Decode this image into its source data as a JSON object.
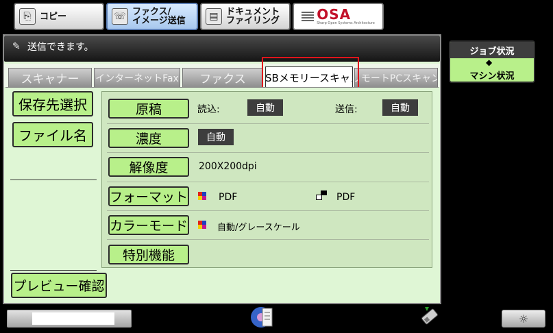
{
  "mode_bar": {
    "copy_label": "コピー",
    "fax_image_label_line1": "ファクス/",
    "fax_image_label_line2": "イメージ送信",
    "doc_filing_label_line1": "ドキュメント",
    "doc_filing_label_line2": "ファイリング",
    "osa_logo_text": "OSA",
    "osa_logo_sub": "Sharp Open Systems Architecture"
  },
  "status": {
    "message": "送信できます。"
  },
  "tabs": [
    {
      "label": "スキャナー",
      "active": false
    },
    {
      "label": "インターネットFax",
      "active": false
    },
    {
      "label": "ファクス",
      "active": false
    },
    {
      "label": "USBメモリースキャン",
      "active": true
    },
    {
      "label": "リモートPCスキャン",
      "active": false
    }
  ],
  "side": {
    "destination_button": "保存先選択",
    "filename_button": "ファイル名",
    "preview_button": "プレビュー確認"
  },
  "settings": {
    "original": {
      "button": "原稿",
      "read_label": "読込:",
      "read_value": "自動",
      "send_label": "送信:",
      "send_value": "自動"
    },
    "exposure": {
      "button": "濃度",
      "value": "自動"
    },
    "resolution": {
      "button": "解像度",
      "value": "200X200dpi"
    },
    "format": {
      "button": "フォーマット",
      "color_value": "PDF",
      "bw_value": "PDF"
    },
    "color_mode": {
      "button": "カラーモード",
      "value": "自動/グレースケール"
    },
    "special": {
      "button": "特別機能"
    }
  },
  "job_status": {
    "top_label": "ジョブ状況",
    "bottom_label": "マシン状況",
    "arrow": "◆"
  },
  "bottom": {
    "brightness_icon": "☼"
  },
  "colors": {
    "button_green": "#b8f08a",
    "panel_bg": "#dff6d5",
    "highlight": "#e0141b"
  }
}
